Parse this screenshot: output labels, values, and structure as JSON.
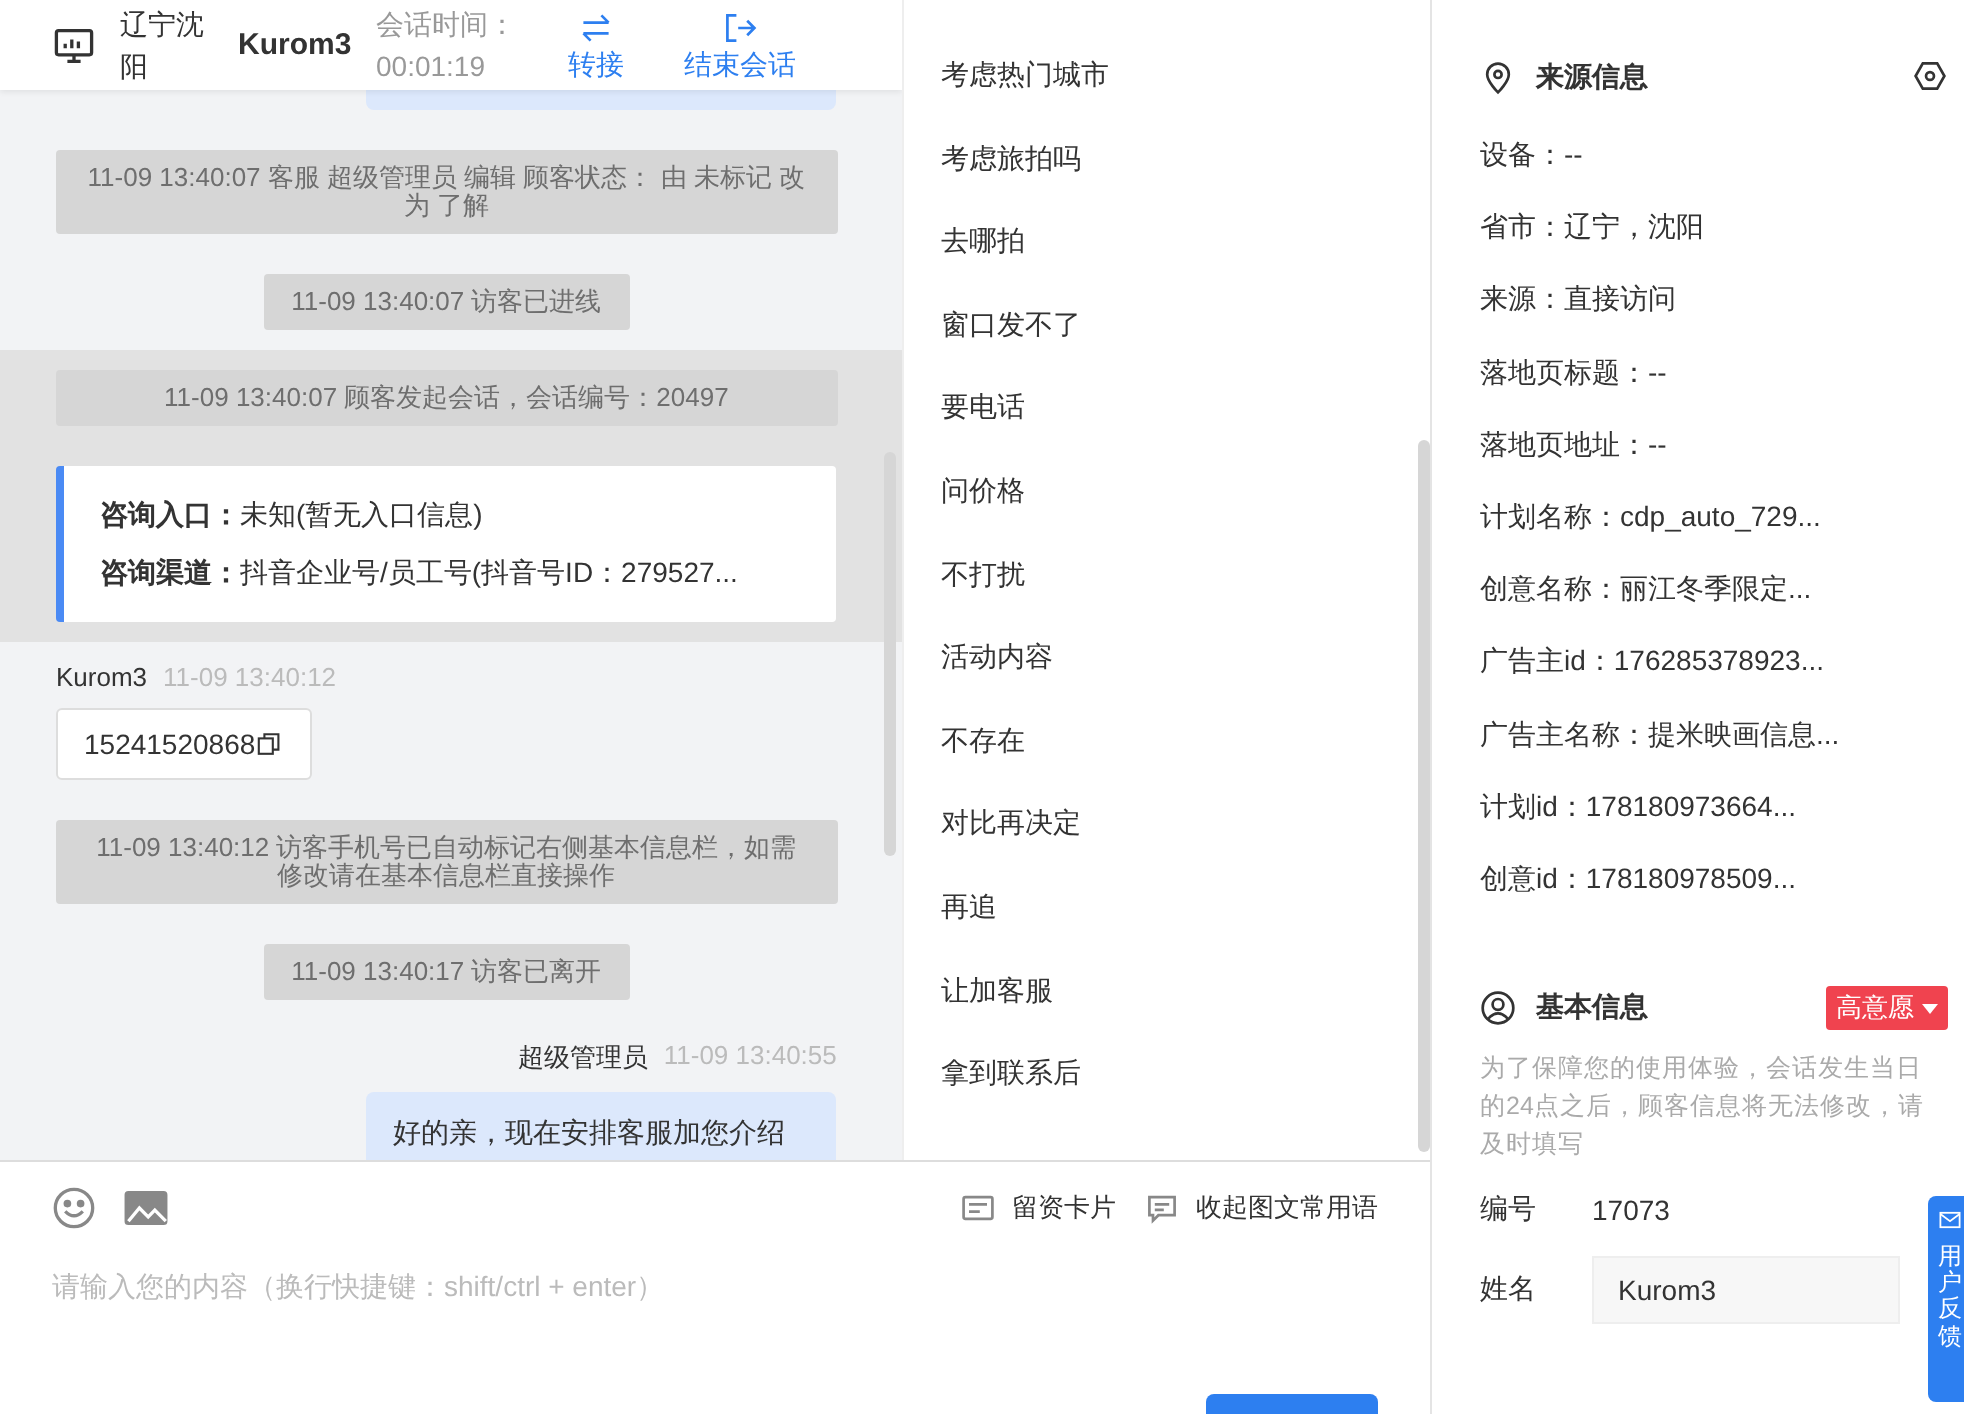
{
  "header": {
    "location": "辽宁沈阳",
    "visitor": "Kurom3",
    "timer_label": "会话时间：",
    "timer": "00:01:19",
    "actions": [
      {
        "kind": "transfer",
        "label": "转接"
      },
      {
        "kind": "end",
        "label": "结束会话"
      }
    ]
  },
  "messages": [
    {
      "kind": "bubble_tail",
      "highlighted": false
    },
    {
      "kind": "notice",
      "highlighted": false,
      "text": "11-09 13:40:07 客服 超级管理员 编辑 顾客状态：  由 未标记 改为 了解"
    },
    {
      "kind": "notice",
      "highlighted": false,
      "text": "11-09 13:40:07 访客已进线"
    },
    {
      "kind": "notice",
      "highlighted": true,
      "text": "11-09 13:40:07 顾客发起会话，会话编号：20497"
    },
    {
      "kind": "entry_card",
      "highlighted": true,
      "rows": [
        {
          "label": "咨询入口：",
          "value": "未知(暂无入口信息)"
        },
        {
          "label": "咨询渠道：",
          "value": "抖音企业号/员工号(抖音号ID：279527..."
        }
      ]
    },
    {
      "kind": "visitor",
      "highlighted": false,
      "sender": "Kurom3",
      "time": "11-09 13:40:12",
      "text": "15241520868"
    },
    {
      "kind": "notice",
      "highlighted": false,
      "text": "11-09 13:40:12 访客手机号已自动标记右侧基本信息栏，如需修改请在基本信息栏直接操作"
    },
    {
      "kind": "notice",
      "highlighted": false,
      "text": "11-09 13:40:17 访客已离开"
    },
    {
      "kind": "agent",
      "highlighted": false,
      "sender": "超级管理员",
      "time": "11-09 13:40:55",
      "text": "好的亲，现在安排客服加您介绍"
    }
  ],
  "phrases": [
    "考虑热门城市",
    "考虑旅拍吗",
    "去哪拍",
    "窗口发不了",
    "要电话",
    "问价格",
    "不打扰",
    "活动内容",
    "不存在",
    "对比再决定",
    "再追",
    "让加客服",
    "拿到联系后"
  ],
  "composer": {
    "tools": [
      {
        "kind": "card",
        "label": "留资卡片"
      },
      {
        "kind": "phrases",
        "label": "收起图文常用语"
      }
    ],
    "placeholder": "请输入您的内容（换行快捷键：shift/ctrl + enter）"
  },
  "source_info": {
    "title": "来源信息",
    "rows": [
      "设备：--",
      "省市：辽宁，沈阳",
      "来源：直接访问",
      "落地页标题：--",
      "落地页地址：--",
      "计划名称：cdp_auto_729...",
      "创意名称：丽江冬季限定...",
      "广告主id：176285378923...",
      "广告主名称：提米映画信息...",
      "计划id：178180973664...",
      "创意id：178180978509..."
    ]
  },
  "basic_info": {
    "title": "基本信息",
    "intent": "高意愿",
    "note": "为了保障您的使用体验，会话发生当日的24点之后，顾客信息将无法修改，请及时填写",
    "fields": [
      {
        "kind": "text",
        "label": "编号",
        "value": "17073"
      },
      {
        "kind": "input",
        "label": "姓名",
        "value": "Kurom3"
      }
    ]
  },
  "feedback_tab": "用户反馈"
}
